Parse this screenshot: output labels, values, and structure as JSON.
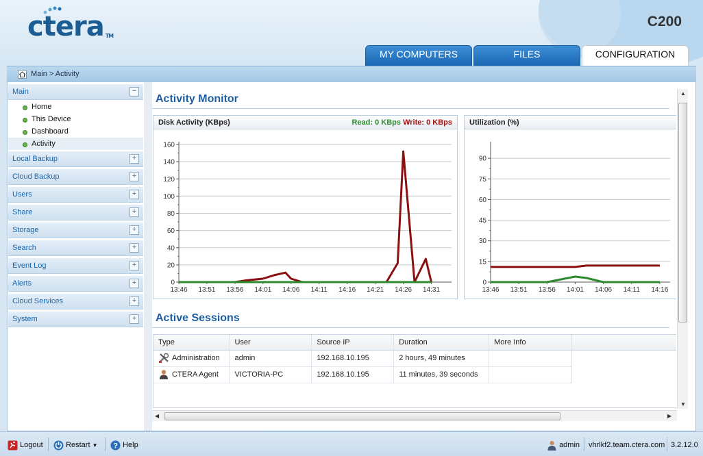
{
  "app": {
    "model": "C200",
    "logo": "ctera",
    "trademark": "TM"
  },
  "tabs": [
    {
      "label": "MY COMPUTERS"
    },
    {
      "label": "FILES"
    },
    {
      "label": "CONFIGURATION",
      "active": true
    }
  ],
  "breadcrumb": "Main > Activity",
  "sidebar": {
    "main_label": "Main",
    "main_items": [
      "Home",
      "This Device",
      "Dashboard",
      "Activity"
    ],
    "selected": "Activity",
    "groups": [
      "Local Backup",
      "Cloud Backup",
      "Users",
      "Share",
      "Storage",
      "Search",
      "Event Log",
      "Alerts",
      "Cloud Services",
      "System"
    ]
  },
  "activity": {
    "title": "Activity Monitor",
    "disk_panel_title": "Disk Activity (KBps)",
    "read_label": "Read: 0 KBps",
    "write_label": "Write: 0 KBps",
    "util_panel_title": "Utilization (%)"
  },
  "sessions": {
    "title": "Active Sessions",
    "columns": [
      "Type",
      "User",
      "Source IP",
      "Duration",
      "More Info"
    ],
    "rows": [
      {
        "type": "Administration",
        "user": "admin",
        "ip": "192.168.10.195",
        "duration": "2 hours, 49 minutes",
        "info": ""
      },
      {
        "type": "CTERA Agent",
        "user": "VICTORIA-PC",
        "ip": "192.168.10.195",
        "duration": "11 minutes, 39 seconds",
        "info": ""
      }
    ]
  },
  "footer": {
    "logout": "Logout",
    "restart": "Restart",
    "help": "Help",
    "user": "admin",
    "host": "vhrlkf2.team.ctera.com",
    "version": "3.2.12.0"
  },
  "colors": {
    "accent": "#1d5fa0",
    "read": "#2e8a2e",
    "write": "#a31313"
  },
  "chart_data": [
    {
      "type": "line",
      "title": "Disk Activity (KBps)",
      "x": [
        "13:46",
        "13:48",
        "13:51",
        "13:53",
        "13:56",
        "13:58",
        "14:01",
        "14:03",
        "14:05",
        "14:06",
        "14:08",
        "14:11",
        "14:13",
        "14:16",
        "14:18",
        "14:21",
        "14:23",
        "14:25",
        "14:26",
        "14:28",
        "14:30",
        "14:31"
      ],
      "x_ticks": [
        "13:46",
        "13:51",
        "13:56",
        "14:01",
        "14:06",
        "14:11",
        "14:16",
        "14:21",
        "14:26",
        "14:31"
      ],
      "ylim": [
        0,
        160
      ],
      "y_ticks": [
        0,
        20,
        40,
        60,
        80,
        100,
        120,
        140,
        160
      ],
      "series": [
        {
          "name": "Write",
          "color": "#8b1010",
          "values": [
            0,
            0,
            0,
            0,
            0,
            2,
            4,
            8,
            11,
            4,
            0,
            0,
            0,
            0,
            0,
            0,
            0,
            22,
            152,
            0,
            27,
            0
          ]
        },
        {
          "name": "Read",
          "color": "#2e8a2e",
          "values": [
            0,
            0,
            0,
            0,
            0,
            0,
            0,
            0,
            0,
            0,
            0,
            0,
            0,
            0,
            0,
            0,
            0,
            0,
            0,
            0,
            0,
            0
          ]
        }
      ],
      "grid": true
    },
    {
      "type": "line",
      "title": "Utilization (%)",
      "x": [
        "13:46",
        "13:51",
        "13:56",
        "14:01",
        "14:03",
        "14:06",
        "14:11",
        "14:16"
      ],
      "x_ticks": [
        "13:46",
        "13:51",
        "13:56",
        "14:01",
        "14:06",
        "14:11",
        "14:16"
      ],
      "ylim": [
        0,
        100
      ],
      "y_ticks": [
        0,
        15,
        30,
        45,
        60,
        75,
        90
      ],
      "series": [
        {
          "color": "#8b1010",
          "values": [
            11,
            11,
            11,
            11,
            12,
            12,
            12,
            12
          ]
        },
        {
          "color": "#2e8a2e",
          "values": [
            0,
            0,
            0,
            4,
            3,
            0,
            0,
            0
          ]
        }
      ],
      "grid": true
    }
  ]
}
